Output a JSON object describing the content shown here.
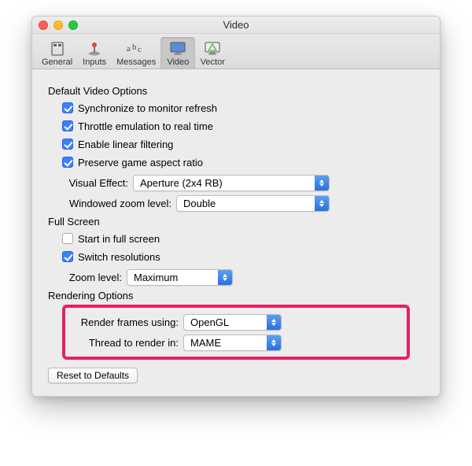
{
  "window": {
    "title": "Video"
  },
  "toolbar": {
    "items": [
      {
        "label": "General"
      },
      {
        "label": "Inputs"
      },
      {
        "label": "Messages"
      },
      {
        "label": "Video"
      },
      {
        "label": "Vector"
      }
    ]
  },
  "sections": {
    "defaults_title": "Default Video Options",
    "fullscreen_title": "Full Screen",
    "rendering_title": "Rendering Options"
  },
  "defaults": {
    "sync": {
      "label": "Synchronize to monitor refresh",
      "checked": true
    },
    "throttle": {
      "label": "Throttle emulation to real time",
      "checked": true
    },
    "linear": {
      "label": "Enable linear filtering",
      "checked": true
    },
    "aspect": {
      "label": "Preserve game aspect ratio",
      "checked": true
    }
  },
  "selects": {
    "visual_effect": {
      "label": "Visual Effect:",
      "value": "Aperture (2x4 RB)"
    },
    "windowed_zoom": {
      "label": "Windowed zoom level:",
      "value": "Double"
    },
    "fs_zoom": {
      "label": "Zoom level:",
      "value": "Maximum"
    },
    "render_frames": {
      "label": "Render frames using:",
      "value": "OpenGL"
    },
    "render_thread": {
      "label": "Thread to render in:",
      "value": "MAME"
    }
  },
  "fullscreen": {
    "start": {
      "label": "Start in full screen",
      "checked": false
    },
    "switch_res": {
      "label": "Switch resolutions",
      "checked": true
    }
  },
  "buttons": {
    "reset": "Reset to Defaults"
  }
}
